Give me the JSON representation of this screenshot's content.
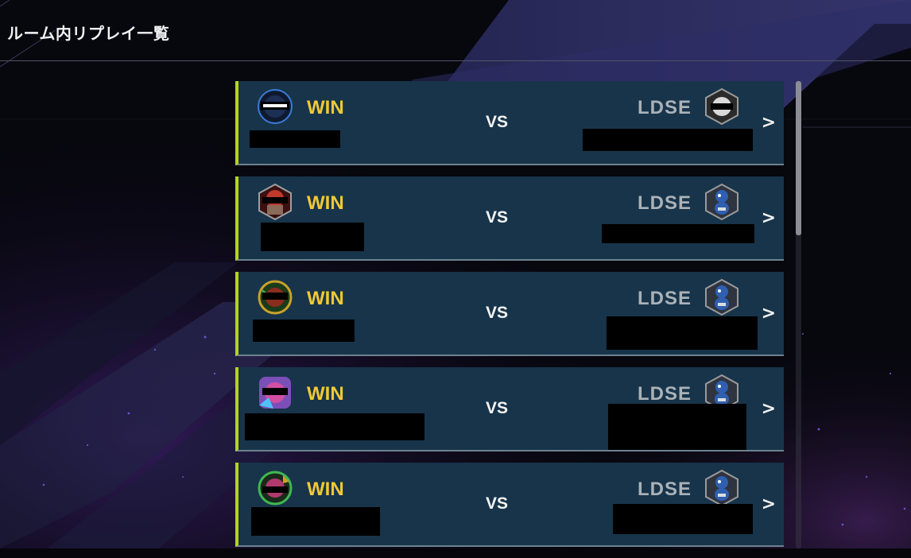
{
  "page": {
    "title": "ルーム内リプレイ一覧"
  },
  "colors": {
    "row_background": "#17344a",
    "row_accent": "#b8d21e",
    "win": "#f2c935",
    "lose": "#aab2b8"
  },
  "replays": [
    {
      "left": {
        "result": "WIN",
        "avatar_icon": "dark-orb-avatar-icon"
      },
      "vs": "VS",
      "right": {
        "result": "LDSE",
        "avatar_icon": "silver-helmet-avatar-icon"
      },
      "chevron": ">"
    },
    {
      "left": {
        "result": "WIN",
        "avatar_icon": "red-warrior-avatar-icon"
      },
      "vs": "VS",
      "right": {
        "result": "LDSE",
        "avatar_icon": "blue-creature-avatar-icon"
      },
      "chevron": ">"
    },
    {
      "left": {
        "result": "WIN",
        "avatar_icon": "green-gold-avatar-icon"
      },
      "vs": "VS",
      "right": {
        "result": "LDSE",
        "avatar_icon": "blue-creature-avatar-icon"
      },
      "chevron": ">"
    },
    {
      "left": {
        "result": "WIN",
        "avatar_icon": "rainbow-avatar-icon"
      },
      "vs": "VS",
      "right": {
        "result": "LDSE",
        "avatar_icon": "blue-creature-avatar-icon"
      },
      "chevron": ">"
    },
    {
      "left": {
        "result": "WIN",
        "avatar_icon": "green-ring-avatar-icon"
      },
      "vs": "VS",
      "right": {
        "result": "LDSE",
        "avatar_icon": "blue-creature-avatar-icon"
      },
      "chevron": ">"
    }
  ],
  "scrollbar": {
    "position": 0.0,
    "visible_fraction": 0.33
  }
}
